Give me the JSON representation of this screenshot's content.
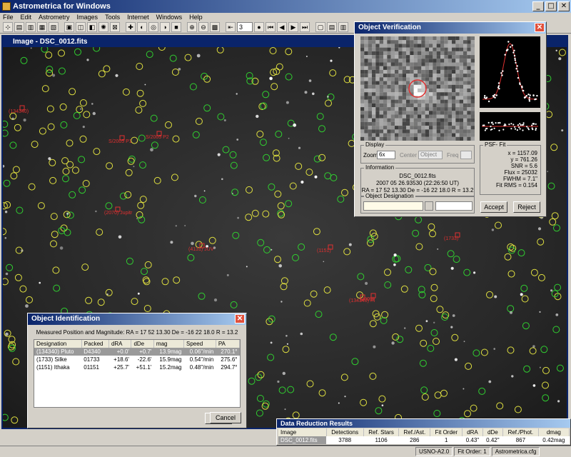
{
  "app": {
    "title": "Astrometrica for Windows"
  },
  "menu": [
    "File",
    "Edit",
    "Astrometry",
    "Images",
    "Tools",
    "Internet",
    "Windows",
    "Help"
  ],
  "toolbar": {
    "frame_value": "3"
  },
  "image_window": {
    "title": "Image - DSC_0012.fits"
  },
  "object_labels": [
    {
      "text": "(134340)"
    },
    {
      "text": "S/2005 P1"
    },
    {
      "text": "S/2005 P2"
    },
    {
      "text": "(2070) Jupitr"
    },
    {
      "text": "(4131) JUV"
    },
    {
      "text": "(1151)"
    },
    {
      "text": "(1733)"
    },
    {
      "text": "(134340) Pl"
    },
    {
      "text": "(2009)"
    }
  ],
  "verification": {
    "title": "Object Verification",
    "display_label": "Display",
    "zoom_label": "Zoom",
    "zoom_value": "6x",
    "center_label": "Center",
    "center_value": "Object",
    "freq_label": "Freq",
    "psf_label": "PSF- Fit",
    "psf_lines": [
      "x = 1157.09",
      "y = 761.26",
      "SNR = 5.6",
      "Flux = 25032",
      "FWHM = 7.1\"",
      "Fit RMS = 0.154"
    ],
    "info_label": "Information",
    "info_lines": [
      "DSC_0012.fits",
      "2007 05 26.93530 (22:26:50 UT)",
      "RA = 17 52 13.30   De = -16 22 18.0   R = 13.2"
    ],
    "designation_label": "Object Designation",
    "accept_label": "Accept",
    "reject_label": "Reject"
  },
  "identification": {
    "title": "Object Identification",
    "measured_text": "Measured Position and Magnitude:  RA = 17 52 13.30   De = -16 22 18.0   R = 13.2",
    "columns": [
      "Designation",
      "Packed",
      "dRA",
      "dDe",
      "mag",
      "Speed",
      "PA"
    ],
    "rows": [
      [
        "(134340) Pluto",
        "D4340",
        "+0.0'",
        "+0.7'",
        "13.9mag",
        "0.06\"/min",
        "270.1°"
      ],
      [
        "(1733) Silke",
        "01733",
        "+18.6'",
        "-22.6'",
        "15.9mag",
        "0.54\"/min",
        "275.6°"
      ],
      [
        "(1151) Ithaka",
        "01151",
        "+25.7'",
        "+51.1'",
        "15.2mag",
        "0.48\"/min",
        "294.7°"
      ]
    ],
    "ok_label": "OK",
    "cancel_label": "Cancel"
  },
  "reduction": {
    "title": "Data Reduction Results",
    "columns": [
      "Image",
      "Detections",
      "Ref. Stars",
      "Ref./Ast.",
      "Fit Order",
      "dRA",
      "dDe",
      "Ref./Phot.",
      "dmag"
    ],
    "row": [
      "DSC_0012.fits",
      "3788",
      "1106",
      "286",
      "1",
      "0.43\"",
      "0.42\"",
      "867",
      "0.42mag"
    ]
  },
  "status": {
    "catalog": "USNO-A2.0",
    "fit_order": "Fit Order: 1",
    "config": "Astrometrica.cfg"
  }
}
